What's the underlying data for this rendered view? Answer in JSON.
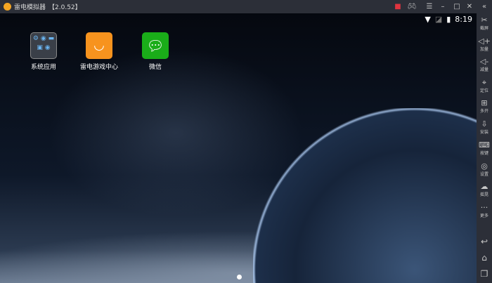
{
  "window": {
    "title": "雷电模拟器",
    "version": "【2.0.52】"
  },
  "status": {
    "time": "8:19"
  },
  "apps": [
    {
      "label": "系统应用"
    },
    {
      "label": "雷电游戏中心"
    },
    {
      "label": "微信"
    }
  ],
  "sidebar": [
    {
      "label": "截屏",
      "icon": "✂"
    },
    {
      "label": "加量",
      "icon": "◁+"
    },
    {
      "label": "减量",
      "icon": "◁-"
    },
    {
      "label": "定位",
      "icon": "⌖"
    },
    {
      "label": "多开",
      "icon": "⊞"
    },
    {
      "label": "安装",
      "icon": "⇩"
    },
    {
      "label": "按键",
      "icon": "⌨"
    },
    {
      "label": "设置",
      "icon": "◎"
    },
    {
      "label": "摇晃",
      "icon": "☁"
    },
    {
      "label": "更多",
      "icon": "···"
    }
  ],
  "nav": {
    "back": "↩",
    "home": "⌂",
    "recents": "❐"
  },
  "colors": {
    "accent": "#f5a623",
    "wechat": "#1aad19"
  }
}
